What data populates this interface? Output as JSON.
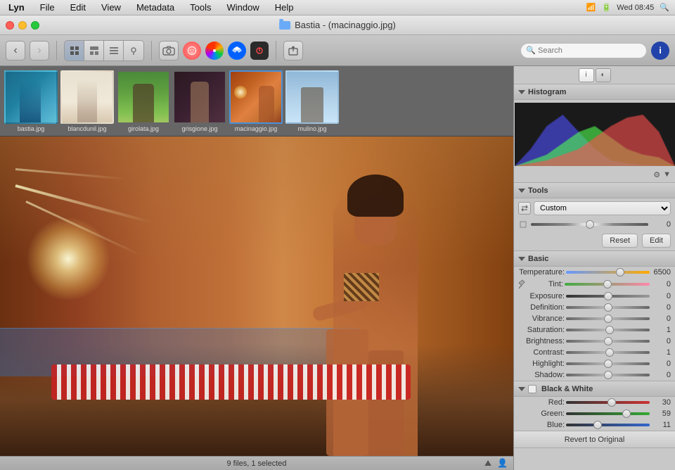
{
  "macos": {
    "menu_items": [
      "Lyn",
      "File",
      "Edit",
      "View",
      "Metadata",
      "Tools",
      "Window",
      "Help"
    ],
    "right_status": "Wed 08:45",
    "title": "Bastia - (macinaggio.jpg)"
  },
  "toolbar": {
    "back_label": "‹",
    "forward_label": "›",
    "view_grid_label": "⊞",
    "view_detail_label": "≡",
    "view_strip_label": "⊟",
    "view_map_label": "◉",
    "camera_label": "📷",
    "face_label": "👤",
    "pinwheel_label": "✦",
    "dropbox_label": "□",
    "app5_label": "◈",
    "search_placeholder": "Search",
    "info_label": "i"
  },
  "thumbnails": [
    {
      "label": "bastia.jpg",
      "selected": false,
      "color_class": "t1"
    },
    {
      "label": "blancdunil.jpg",
      "selected": false,
      "color_class": "t2"
    },
    {
      "label": "girolata.jpg",
      "selected": false,
      "color_class": "t3"
    },
    {
      "label": "grisgione.jpg",
      "selected": false,
      "color_class": "t4"
    },
    {
      "label": "macinaggio.jpg",
      "selected": true,
      "color_class": "t5"
    },
    {
      "label": "mulino.jpg",
      "selected": false,
      "color_class": "t6"
    }
  ],
  "statusbar": {
    "text": "9 files, 1 selected"
  },
  "right_panel": {
    "info_tab_label": "i",
    "color_tab_label": "◐",
    "histogram_section": "Histogram",
    "tools_section": "Tools",
    "basic_section": "Basic",
    "bw_section": "Black & White",
    "custom_label": "Custom",
    "reset_label": "Reset",
    "edit_label": "Edit",
    "revert_label": "Revert to Original",
    "sliders": {
      "temperature": {
        "label": "Temperature:",
        "value": "6500",
        "percent": 65
      },
      "tint": {
        "label": "Tint:",
        "value": "0",
        "percent": 50
      },
      "exposure": {
        "label": "Exposure:",
        "value": "0",
        "percent": 50
      },
      "definition": {
        "label": "Definition:",
        "value": "0",
        "percent": 50
      },
      "vibrance": {
        "label": "Vibrance:",
        "value": "0",
        "percent": 50
      },
      "saturation": {
        "label": "Saturation:",
        "value": "1",
        "percent": 52
      },
      "brightness": {
        "label": "Brightness:",
        "value": "0",
        "percent": 50
      },
      "contrast": {
        "label": "Contrast:",
        "value": "1",
        "percent": 52
      },
      "highlight": {
        "label": "Highlight:",
        "value": "0",
        "percent": 50
      },
      "shadow": {
        "label": "Shadow:",
        "value": "0",
        "percent": 50
      }
    },
    "bw_sliders": {
      "red": {
        "label": "Red:",
        "value": "30",
        "percent": 55
      },
      "green": {
        "label": "Green:",
        "value": "59",
        "percent": 72
      },
      "blue": {
        "label": "Blue:",
        "value": "11",
        "percent": 38
      }
    }
  }
}
